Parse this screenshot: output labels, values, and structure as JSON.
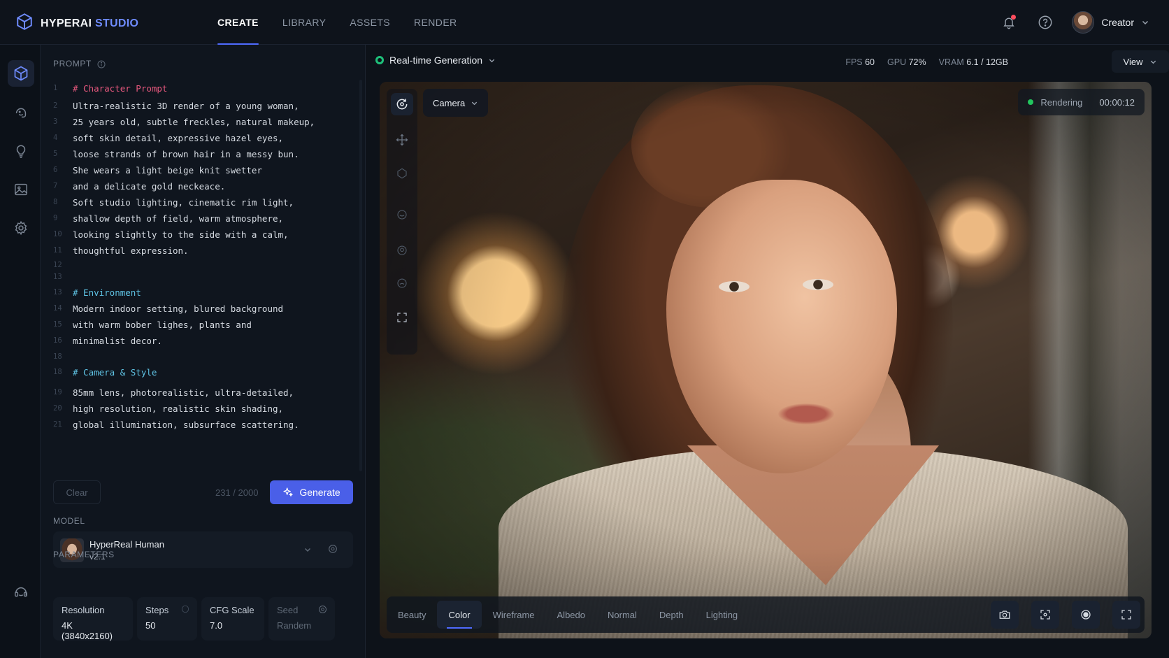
{
  "brand": {
    "name": "HYPERAI",
    "accent": "STUDIO"
  },
  "nav": [
    "CREATE",
    "LIBRARY",
    "ASSETS",
    "RENDER"
  ],
  "user": {
    "name": "Creator"
  },
  "prompt": {
    "label": "PROMPT",
    "lines": [
      {
        "n": "1",
        "text": "# Character Prompt",
        "kind": "comment-pink"
      },
      {
        "n": "2",
        "text": "Ultra-realistic 3D render of a young woman,",
        "kind": "text"
      },
      {
        "n": "3",
        "text": "25 years old, subtle freckles, natural makeup,",
        "kind": "text"
      },
      {
        "n": "4",
        "text": "soft skin detail, expressive hazel eyes,",
        "kind": "text"
      },
      {
        "n": "5",
        "text": "loose strands of brown hair in a messy bun.",
        "kind": "text"
      },
      {
        "n": "6",
        "text": "She wears a light beige knit swetter",
        "kind": "text"
      },
      {
        "n": "7",
        "text": "and a delicate gold neckeace.",
        "kind": "text"
      },
      {
        "n": "8",
        "text": "Soft studio lighting, cinematic rim light,",
        "kind": "text"
      },
      {
        "n": "9",
        "text": "shallow depth of field, warm atmosphere,",
        "kind": "text"
      },
      {
        "n": "10",
        "text": "looking slightly to the side with a calm,",
        "kind": "text"
      },
      {
        "n": "11",
        "text": "thoughtful expression.",
        "kind": "text"
      },
      {
        "n": "12",
        "text": "",
        "kind": "text"
      },
      {
        "n": "13",
        "text": "",
        "kind": "text"
      },
      {
        "n": "13",
        "text": "# Environment",
        "kind": "comment-cyan"
      },
      {
        "n": "14",
        "text": "Modern indoor setting, blured background",
        "kind": "text"
      },
      {
        "n": "15",
        "text": "with warm bober lighes, plants and",
        "kind": "text"
      },
      {
        "n": "16",
        "text": "minimalist decor.",
        "kind": "text"
      },
      {
        "n": "18",
        "text": "",
        "kind": "text"
      },
      {
        "n": "18",
        "text": "# Camera & Style",
        "kind": "comment-cyan"
      },
      {
        "n": "19",
        "text": "85mm lens, photorealistic, ultra-detailed,",
        "kind": "text"
      },
      {
        "n": "20",
        "text": "high resolution, realistic skin shading,",
        "kind": "text"
      },
      {
        "n": "21",
        "text": "global illumination, subsurface scattering.",
        "kind": "text"
      }
    ],
    "clear_label": "Clear",
    "char_count": "231 / 2000",
    "generate_label": "Generate"
  },
  "model": {
    "label": "MODEL",
    "name": "HyperReal Human",
    "version": "v2.1"
  },
  "parameters": {
    "label": "PARAMETERS",
    "items": [
      {
        "name": "Resolution",
        "value": "4K (3840x2160)"
      },
      {
        "name": "Steps",
        "value": "50"
      },
      {
        "name": "CFG Scale",
        "value": "7.0"
      },
      {
        "name": "Seed",
        "value": "Randem"
      }
    ]
  },
  "viewport": {
    "mode_label": "Real-time Generation",
    "stats": {
      "fps_label": "FPS",
      "fps": "60",
      "gpu_label": "GPU",
      "gpu": "72%",
      "vram_label": "VRAM",
      "vram": "6.1 / 12GB"
    },
    "view_label": "View",
    "camera_label": "Camera",
    "status_label": "Rendering",
    "timer": "00:00:12",
    "tabs": [
      "Beauty",
      "Color",
      "Wireframe",
      "Albedo",
      "Normal",
      "Depth",
      "Lighting"
    ]
  },
  "colors": {
    "accent": "#4f6bff",
    "generate": "#4a5fe8",
    "live": "#1ec07a",
    "comment_pink": "#e8587e",
    "comment_cyan": "#5fc3e4"
  }
}
